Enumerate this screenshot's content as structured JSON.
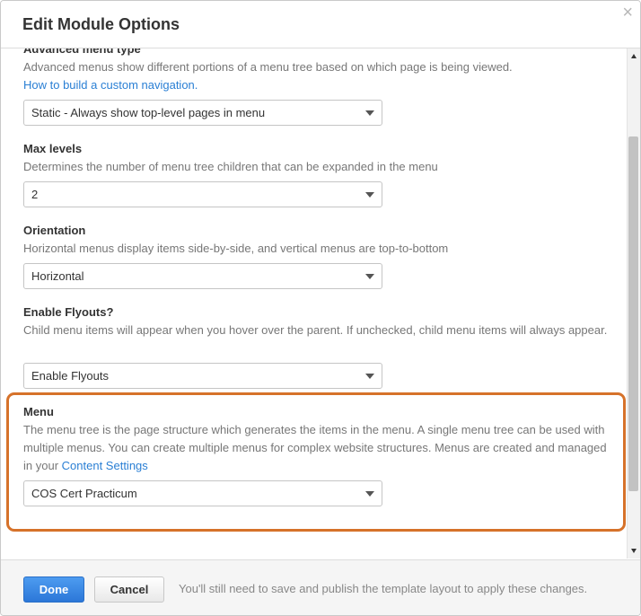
{
  "dialog": {
    "title": "Edit Module Options",
    "close_glyph": "×"
  },
  "fields": {
    "advanced": {
      "label": "Advanced menu type",
      "description": "Advanced menus show different portions of a menu tree based on which page is being viewed.",
      "link": "How to build a custom navigation.",
      "value": "Static - Always show top-level pages in menu"
    },
    "max_levels": {
      "label": "Max levels",
      "description": "Determines the number of menu tree children that can be expanded in the menu",
      "value": "2"
    },
    "orientation": {
      "label": "Orientation",
      "description": "Horizontal menus display items side-by-side, and vertical menus are top-to-bottom",
      "value": "Horizontal"
    },
    "flyouts": {
      "label": "Enable Flyouts?",
      "description": "Child menu items will appear when you hover over the parent. If unchecked, child menu items will always appear.",
      "value": "Enable Flyouts"
    },
    "menu": {
      "label": "Menu",
      "description": "The menu tree is the page structure which generates the items in the menu. A single menu tree can be used with multiple menus. You can create multiple menus for complex website structures. Menus are created and managed in your",
      "link": "Content Settings",
      "value": "COS Cert Practicum"
    }
  },
  "footer": {
    "done_label": "Done",
    "cancel_label": "Cancel",
    "note": "You'll still need to save and publish the template layout to apply these changes."
  },
  "colors": {
    "accent": "#2a7fd4",
    "highlight": "#d6722a"
  }
}
